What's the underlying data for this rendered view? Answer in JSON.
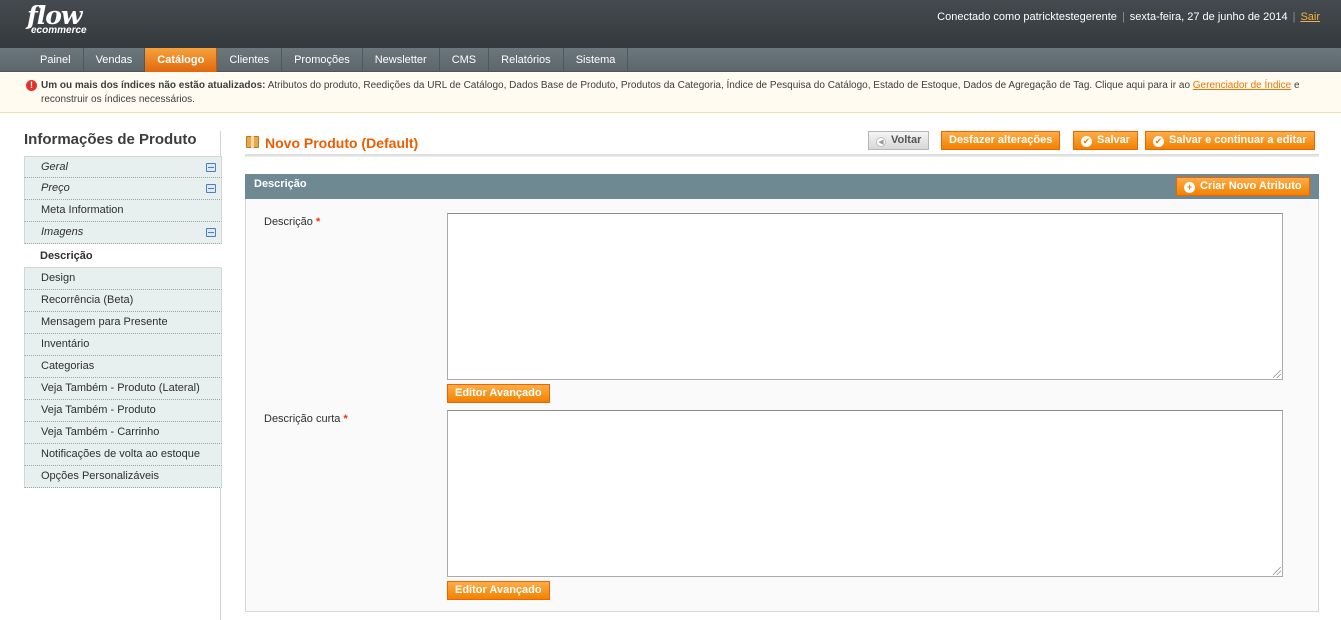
{
  "header": {
    "logo_main": "flow",
    "logo_sub": "ecommerce",
    "logged_in": "Conectado como patricktestegerente",
    "date": "sexta-feira, 27 de junho de 2014",
    "logout": "Sair"
  },
  "nav": {
    "items": [
      {
        "label": "Painel"
      },
      {
        "label": "Vendas"
      },
      {
        "label": "Catálogo",
        "active": true
      },
      {
        "label": "Clientes"
      },
      {
        "label": "Promoções"
      },
      {
        "label": "Newsletter"
      },
      {
        "label": "CMS"
      },
      {
        "label": "Relatórios"
      },
      {
        "label": "Sistema"
      }
    ]
  },
  "notice": {
    "bold": "Um ou mais dos índices não estão atualizados:",
    "text": " Atributos do produto, Reedições da URL de Catálogo, Dados Base de Produto, Produtos da Categoria, Índice de Pesquisa do Catálogo, Estado de Estoque, Dados de Agregação de Tag. Clique aqui para ir ao ",
    "link": "Gerenciador de Índice",
    "after": " e reconstruir os índices necessários."
  },
  "sidebar": {
    "title": "Informações de Produto",
    "tabs": [
      {
        "label": "Geral",
        "changed": true
      },
      {
        "label": "Preço",
        "changed": true
      },
      {
        "label": "Meta Information"
      },
      {
        "label": "Imagens",
        "changed": true
      },
      {
        "label": "Descrição",
        "active": true
      },
      {
        "label": "Design"
      },
      {
        "label": "Recorrência (Beta)"
      },
      {
        "label": "Mensagem para Presente"
      },
      {
        "label": "Inventário"
      },
      {
        "label": "Categorias"
      },
      {
        "label": "Veja Também - Produto (Lateral)"
      },
      {
        "label": "Veja Também - Produto"
      },
      {
        "label": "Veja Também - Carrinho"
      },
      {
        "label": "Notificações de volta ao estoque"
      },
      {
        "label": "Opções Personalizáveis"
      }
    ]
  },
  "main": {
    "title": "Novo Produto (Default)",
    "buttons": {
      "back": "Voltar",
      "reset": "Desfazer alterações",
      "save": "Salvar",
      "save_continue": "Salvar e continuar a editar"
    },
    "section": {
      "title": "Descrição",
      "create_attr": "Criar Novo Atributo",
      "fields": [
        {
          "label": "Descrição",
          "value": "",
          "editor_button": "Editor Avançado"
        },
        {
          "label": "Descrição curta",
          "value": "",
          "editor_button": "Editor Avançado"
        }
      ]
    }
  },
  "colors": {
    "accent": "#eb5e00",
    "button": "#f18200",
    "section_header": "#6f8992",
    "required": "#eb340a"
  }
}
